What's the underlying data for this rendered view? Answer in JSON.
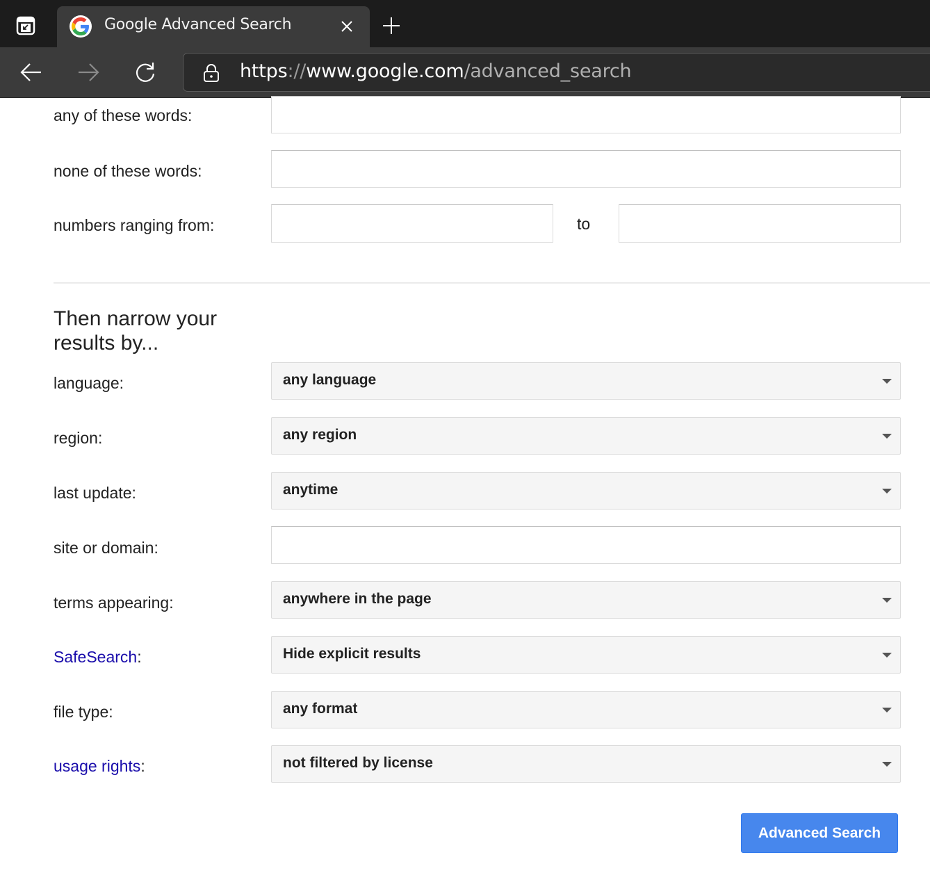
{
  "browser": {
    "tab": {
      "title": "Google Advanced Search",
      "favicon": "google-g-logo"
    },
    "url": {
      "scheme": "https",
      "separator": "://",
      "host": "www.google.com",
      "path": "/advanced_search"
    },
    "icons": {
      "sidebar": "sidebar-panel-icon",
      "close_tab": "close-icon",
      "new_tab": "plus-icon",
      "back": "arrow-left-icon",
      "forward": "arrow-right-icon",
      "reload": "reload-icon",
      "lock": "lock-icon"
    }
  },
  "form": {
    "find_fields": [
      {
        "label": "any of these words:",
        "value": ""
      },
      {
        "label": "none of these words:",
        "value": ""
      }
    ],
    "number_range": {
      "label": "numbers ranging from:",
      "from_value": "",
      "to_label": "to",
      "to_value": ""
    },
    "narrow_title": "Then narrow your results by...",
    "filters": [
      {
        "label": "language",
        "type": "select",
        "value": "any language",
        "link": false
      },
      {
        "label": "region",
        "type": "select",
        "value": "any region",
        "link": false
      },
      {
        "label": "last update",
        "type": "select",
        "value": "anytime",
        "link": false
      },
      {
        "label": "site or domain",
        "type": "text",
        "value": "",
        "link": false
      },
      {
        "label": "terms appearing",
        "type": "select",
        "value": "anywhere in the page",
        "link": false
      },
      {
        "label": "SafeSearch",
        "type": "select",
        "value": "Hide explicit results",
        "link": true
      },
      {
        "label": "file type",
        "type": "select",
        "value": "any format",
        "link": false
      },
      {
        "label": "usage rights",
        "type": "select",
        "value": "not filtered by license",
        "link": true
      }
    ],
    "colon": ":",
    "submit_label": "Advanced Search"
  },
  "colors": {
    "link": "#1a0dab",
    "submit_bg": "#4787ed",
    "chrome_dark": "#1c1c1c",
    "chrome_tab": "#3b3b3b"
  }
}
